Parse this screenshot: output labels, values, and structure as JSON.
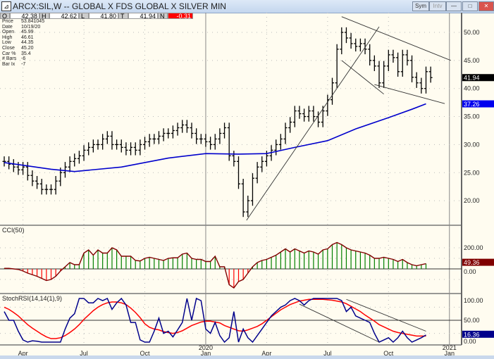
{
  "window": {
    "title": "ARCX:SIL,W -- GLOBAL X FDS GLOBAL X SILVER MIN",
    "buttons": {
      "sym": "Sym",
      "intv": "Intv",
      "min": "—",
      "max": "□",
      "close": "✕"
    }
  },
  "ohlc_bar": {
    "o_label": "O",
    "o": "42.38",
    "h_label": "H",
    "h": "42.62",
    "l_label": "L",
    "l": "41.80",
    "t_label": "T",
    "t": "41.94",
    "n_label": "N",
    "n": "-0.31"
  },
  "info_panel": [
    {
      "k": "Price",
      "v": "53.841045"
    },
    {
      "k": "Date",
      "v": "10/19/20"
    },
    {
      "k": "Open",
      "v": "45.99"
    },
    {
      "k": "High",
      "v": "46.61"
    },
    {
      "k": "Low",
      "v": "44.35"
    },
    {
      "k": "Close",
      "v": "45.20"
    },
    {
      "k": "Car %",
      "v": "35.4"
    },
    {
      "k": "# Bars",
      "v": "-6"
    },
    {
      "k": "Bar Ix",
      "v": "-7"
    }
  ],
  "colors": {
    "up": "#008000",
    "down": "#ff0000",
    "ma": "#0000cc",
    "stochK": "#00008b",
    "stochD": "#ff0000",
    "cciLine": "#800000"
  },
  "chart_data": [
    {
      "type": "ohlc",
      "title": "ARCX:SIL,W",
      "x_labels": [
        {
          "i": 4,
          "t": "Apr"
        },
        {
          "i": 17,
          "t": "Jul"
        },
        {
          "i": 30,
          "t": "Oct"
        },
        {
          "i": 43,
          "t": "Jan",
          "y": "2020"
        },
        {
          "i": 56,
          "t": "Apr"
        },
        {
          "i": 69,
          "t": "Jul"
        },
        {
          "i": 82,
          "t": "Oct"
        },
        {
          "i": 95,
          "t": "Jan",
          "y": "2021"
        }
      ],
      "ylim": [
        15,
        53
      ],
      "y_ticks": [
        "20.00",
        "25.00",
        "30.00",
        "35.00",
        "40.00",
        "45.00",
        "50.00"
      ],
      "close": [
        27,
        26.5,
        26,
        25.5,
        26,
        24.5,
        23.5,
        23,
        22,
        22,
        22,
        23.5,
        25,
        26,
        27,
        27.5,
        28,
        29,
        29.5,
        30,
        30,
        31,
        31.5,
        30,
        30,
        29.5,
        29,
        29.5,
        29,
        30,
        30.5,
        31,
        31,
        31.5,
        32,
        32,
        32.5,
        33,
        33.5,
        33,
        32,
        31,
        31,
        30.5,
        30,
        31,
        32,
        33,
        28,
        27,
        23,
        18,
        20,
        24,
        26,
        27,
        28,
        29,
        30,
        31,
        33,
        34,
        36,
        35.5,
        35,
        36,
        35,
        34,
        36,
        38,
        41,
        47,
        50,
        49,
        48,
        47.5,
        48,
        47,
        45,
        44,
        41,
        44,
        46,
        45.5,
        43,
        46,
        45,
        42,
        41,
        40,
        43,
        41.94
      ],
      "ma": [
        [
          0,
          26.8
        ],
        [
          10,
          25.6
        ],
        [
          15,
          25.2
        ],
        [
          25,
          26
        ],
        [
          35,
          27.6
        ],
        [
          43,
          28.4
        ],
        [
          50,
          28.3
        ],
        [
          56,
          28.4
        ],
        [
          62,
          29.5
        ],
        [
          69,
          30.7
        ],
        [
          75,
          32.8
        ],
        [
          82,
          34.8
        ],
        [
          87,
          36.3
        ],
        [
          90,
          37.26
        ]
      ],
      "last_label": "41.94",
      "ma_label": "37.26",
      "trendlines": [
        [
          [
            51.7,
            16.5
          ],
          [
            80,
            51
          ]
        ],
        [
          [
            72,
            52.8
          ],
          [
            95.3,
            45
          ]
        ],
        [
          [
            72,
            45
          ],
          [
            81,
            39
          ]
        ],
        [
          [
            79,
            40.7
          ],
          [
            94,
            37.3
          ]
        ]
      ]
    },
    {
      "type": "bar",
      "title": "CCI(50)",
      "ylim": [
        -220,
        280
      ],
      "y_ticks": [
        "0.00",
        "200.00"
      ],
      "last_label": "49.36",
      "values": [
        5,
        5,
        0,
        -5,
        -20,
        -40,
        -55,
        -70,
        -90,
        -110,
        -100,
        -70,
        -20,
        20,
        60,
        40,
        40,
        150,
        180,
        130,
        180,
        150,
        150,
        200,
        180,
        120,
        120,
        120,
        80,
        75,
        100,
        110,
        100,
        90,
        80,
        100,
        105,
        105,
        140,
        150,
        100,
        90,
        90,
        70,
        70,
        120,
        20,
        20,
        -150,
        -180,
        -120,
        -100,
        -40,
        20,
        60,
        80,
        90,
        110,
        130,
        160,
        190,
        160,
        190,
        170,
        150,
        170,
        160,
        140,
        180,
        190,
        230,
        250,
        230,
        200,
        180,
        170,
        160,
        150,
        130,
        100,
        100,
        110,
        100,
        90,
        70,
        90,
        60,
        40,
        30,
        40,
        49.36
      ]
    },
    {
      "type": "line",
      "title": "StochRSI(14,14(1),9)",
      "ylim": [
        0,
        100
      ],
      "y_ticks": [
        "0.00",
        "50.00",
        "100.00"
      ],
      "last_label": "16.36",
      "k": [
        70,
        50,
        50,
        25,
        5,
        0,
        3,
        2,
        0,
        0,
        0,
        0,
        0,
        30,
        55,
        65,
        100,
        100,
        90,
        90,
        100,
        95,
        100,
        75,
        90,
        100,
        85,
        45,
        45,
        5,
        0,
        0,
        25,
        55,
        20,
        25,
        12,
        28,
        45,
        100,
        50,
        100,
        95,
        30,
        20,
        45,
        15,
        0,
        10,
        70,
        0,
        30,
        10,
        0,
        15,
        30,
        45,
        60,
        70,
        80,
        85,
        95,
        100,
        95,
        85,
        95,
        100,
        100,
        100,
        100,
        100,
        100,
        95,
        70,
        80,
        60,
        55,
        50,
        45,
        20,
        0,
        5,
        10,
        0,
        10,
        25,
        10,
        0,
        5,
        10,
        16.36
      ],
      "d": [
        80,
        75,
        68,
        60,
        50,
        40,
        32,
        25,
        18,
        12,
        8,
        8,
        10,
        15,
        22,
        30,
        40,
        52,
        62,
        72,
        80,
        86,
        90,
        92,
        92,
        90,
        86,
        78,
        68,
        56,
        42,
        34,
        30,
        28,
        24,
        22,
        20,
        22,
        26,
        32,
        38,
        42,
        46,
        48,
        48,
        46,
        44,
        38,
        34,
        30,
        26,
        25,
        28,
        32,
        36,
        42,
        50,
        58,
        66,
        74,
        80,
        86,
        90,
        94,
        96,
        98,
        98,
        98,
        98,
        97,
        96,
        94,
        92,
        88,
        82,
        76,
        70,
        62,
        55,
        48,
        40,
        35,
        30,
        25,
        22,
        20,
        18,
        16,
        14,
        14,
        14
      ]
    }
  ]
}
